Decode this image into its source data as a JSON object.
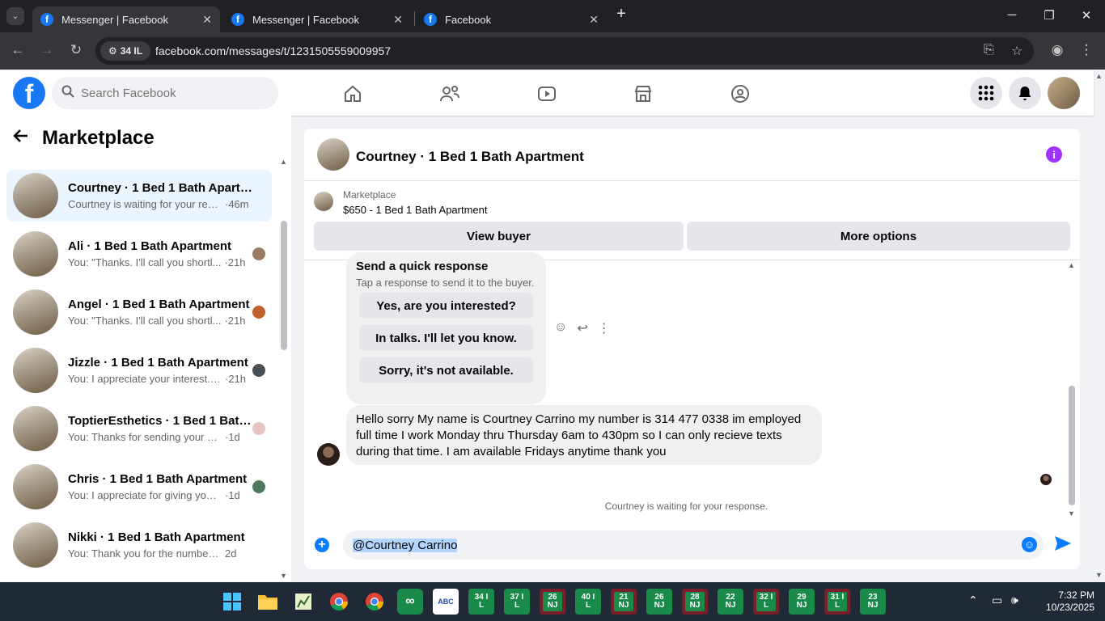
{
  "browser": {
    "tabs": [
      {
        "title": "Messenger | Facebook",
        "active": true
      },
      {
        "title": "Messenger | Facebook",
        "active": false
      },
      {
        "title": "Facebook",
        "active": false
      }
    ],
    "address_badge": "34 IL",
    "url": "facebook.com/messages/t/1231505559009957"
  },
  "fb": {
    "search_placeholder": "Search Facebook",
    "brand_color": "#1877f2"
  },
  "sidebar": {
    "title": "Marketplace",
    "conversations": [
      {
        "name": "Courtney · 1 Bed 1 Bath Apartme...",
        "preview": "Courtney is waiting for your resp...",
        "time": "·46m",
        "selected": true
      },
      {
        "name": "Ali · 1 Bed 1 Bath Apartment",
        "preview": "You: \"Thanks. I'll call you shortl...",
        "time": "·21h"
      },
      {
        "name": "Angel · 1 Bed 1 Bath Apartment",
        "preview": "You: \"Thanks. I'll call you shortl...",
        "time": "·21h"
      },
      {
        "name": "Jizzle · 1 Bed 1 Bath Apartment",
        "preview": "You: I appreciate your interest. ...",
        "time": "·21h"
      },
      {
        "name": "ToptierEsthetics · 1 Bed 1 Bath ...",
        "preview": "You: Thanks for sending your nu...",
        "time": "·1d"
      },
      {
        "name": "Chris · 1 Bed 1 Bath Apartment",
        "preview": "You: I appreciate for giving your ...",
        "time": "·1d"
      },
      {
        "name": "Nikki · 1 Bed 1 Bath Apartment",
        "preview": "You: Thank you for the number you...",
        "time": "2d"
      }
    ]
  },
  "chat": {
    "title": "Courtney · 1 Bed 1 Bath Apartment",
    "listing_label": "Marketplace",
    "listing_price": "$650 - 1 Bed 1 Bath Apartment",
    "view_buyer": "View buyer",
    "more_options": "More options",
    "quick": {
      "heading": "Send a quick response",
      "sub": "Tap a response to send it to the buyer.",
      "options": [
        "Yes, are you interested?",
        "In talks. I'll let you know.",
        "Sorry, it's not available."
      ]
    },
    "message": "Hello sorry My name is Courtney Carrino my number is 314 477 0338 im employed full time I work Monday thru Thursday 6am to 430pm so I can only recieve texts during that time. I am available Fridays anytime thank you",
    "waiting": "Courtney is waiting for your response.",
    "composer_text": "@Courtney Carrino"
  },
  "taskbar": {
    "badges": [
      {
        "top": "34 I",
        "bottom": "L",
        "style": "g"
      },
      {
        "top": "37 I",
        "bottom": "L",
        "style": "g"
      },
      {
        "top": "26",
        "bottom": "NJ",
        "style": "r"
      },
      {
        "top": "40 I",
        "bottom": "L",
        "style": "g"
      },
      {
        "top": "21",
        "bottom": "NJ",
        "style": "r"
      },
      {
        "top": "26",
        "bottom": "NJ",
        "style": "g"
      },
      {
        "top": "28",
        "bottom": "NJ",
        "style": "r"
      },
      {
        "top": "22",
        "bottom": "NJ",
        "style": "g"
      },
      {
        "top": "32 I",
        "bottom": "L",
        "style": "r"
      },
      {
        "top": "29",
        "bottom": "NJ",
        "style": "g"
      },
      {
        "top": "31 I",
        "bottom": "L",
        "style": "r"
      },
      {
        "top": "23",
        "bottom": "NJ",
        "style": "g"
      }
    ],
    "time": "7:32 PM",
    "date": "10/23/2025"
  }
}
